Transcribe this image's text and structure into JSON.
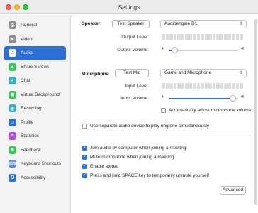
{
  "window": {
    "title": "Settings"
  },
  "sidebar": {
    "items": [
      {
        "label": "General",
        "icon": "gear-icon",
        "color": "#8e8e93",
        "glyph": "⚙"
      },
      {
        "label": "Video",
        "icon": "video-icon",
        "color": "#8e8e93",
        "glyph": "▶"
      },
      {
        "label": "Audio",
        "icon": "headphones-icon",
        "color": "#2d6fd5",
        "glyph": "♫",
        "active": true
      },
      {
        "label": "Share Screen",
        "icon": "share-screen-icon",
        "color": "#34c759",
        "glyph": "▲"
      },
      {
        "label": "Chat",
        "icon": "chat-icon",
        "color": "#30b0c7",
        "glyph": "●"
      },
      {
        "label": "Virtual Background",
        "icon": "virtual-background-icon",
        "color": "#34c759",
        "glyph": "◼"
      },
      {
        "label": "Recording",
        "icon": "recording-icon",
        "color": "#30b0c7",
        "glyph": "◉"
      },
      {
        "label": "Profile",
        "icon": "profile-icon",
        "color": "#2d6fd5",
        "glyph": "☺"
      },
      {
        "label": "Statistics",
        "icon": "statistics-icon",
        "color": "#af52de",
        "glyph": "≡"
      },
      {
        "label": "Feedback",
        "icon": "feedback-icon",
        "color": "#34c759",
        "glyph": "☻"
      },
      {
        "label": "Keyboard Shortcuts",
        "icon": "keyboard-icon",
        "color": "#5a8dd6",
        "glyph": "⌨"
      },
      {
        "label": "Accessibility",
        "icon": "accessibility-icon",
        "color": "#2d6fd5",
        "glyph": "✪"
      }
    ]
  },
  "speaker": {
    "section_label": "Speaker",
    "test_button": "Test Speaker",
    "device": "Audioengine D1",
    "output_level_label": "Output Level:",
    "output_volume_label": "Output Volume:",
    "volume": 0.05
  },
  "microphone": {
    "section_label": "Microphone",
    "test_button": "Test Mic",
    "device": "Game and Microphone",
    "input_level_label": "Input Level:",
    "input_volume_label": "Input Volume:",
    "volume": 0.97,
    "auto_adjust_label": "Automatically adjust microphone volume",
    "auto_adjust": false
  },
  "options": {
    "separate_device_label": "Use separate audio device to play ringtone simultaneously",
    "separate_device": false,
    "join_audio_label": "Join audio by computer when joining a meeting",
    "join_audio": true,
    "mute_mic_label": "Mute microphone when joining a meeting",
    "mute_mic": true,
    "stereo_label": "Enable stereo",
    "stereo": true,
    "space_unmute_label": "Press and hold SPACE key to temporarily unmute yourself",
    "space_unmute": true
  },
  "advanced_button": "Advanced",
  "colors": {
    "accent": "#2d6fd5"
  }
}
